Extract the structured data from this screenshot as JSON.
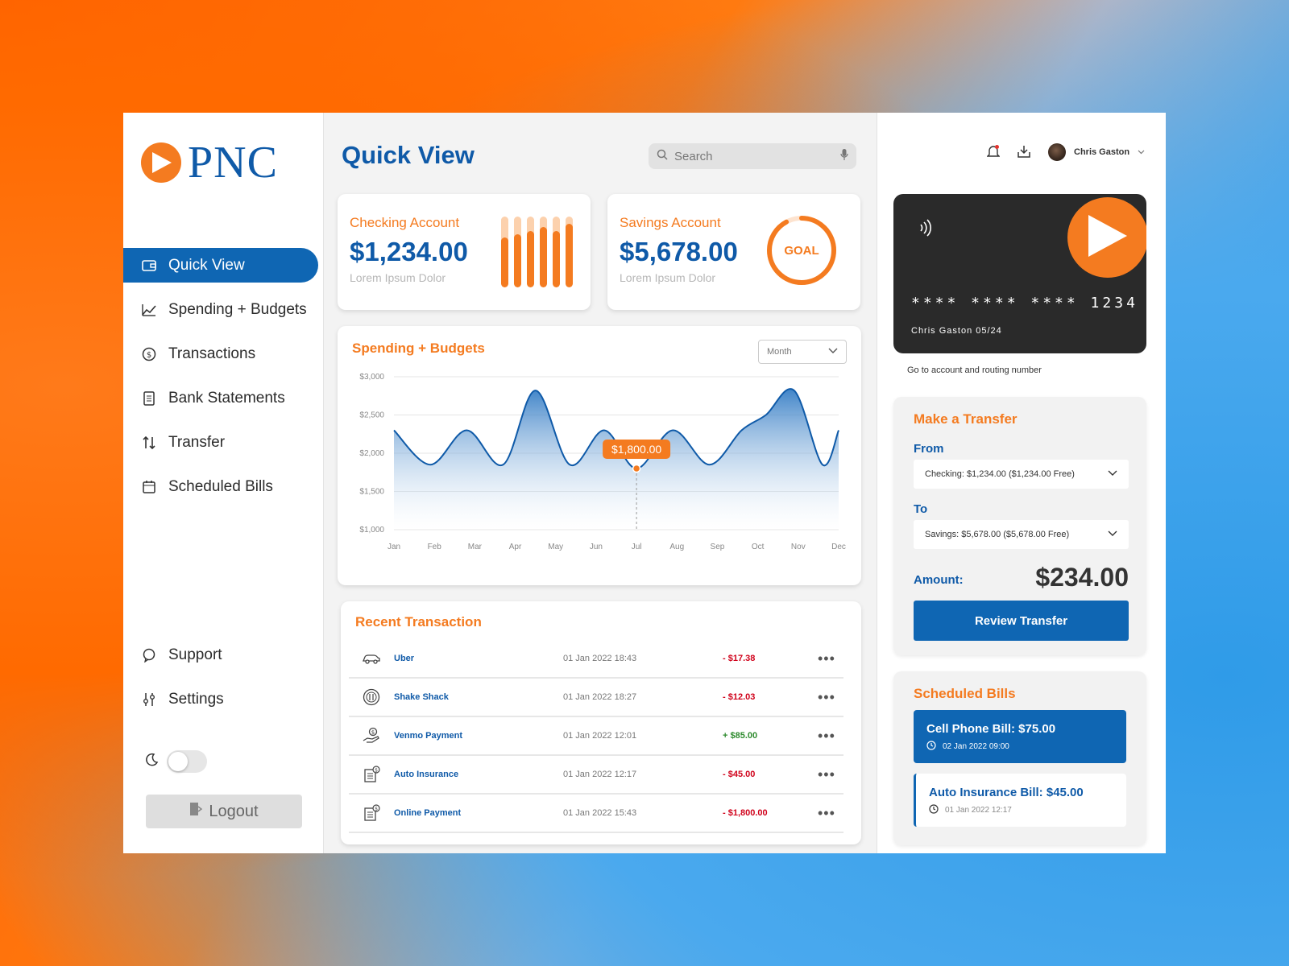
{
  "brand": {
    "name": "PNC"
  },
  "sidebar": {
    "items": [
      {
        "label": "Quick View",
        "icon": "wallet-icon",
        "active": true
      },
      {
        "label": "Spending + Budgets",
        "icon": "trend-icon"
      },
      {
        "label": "Transactions",
        "icon": "dollar-circle-icon"
      },
      {
        "label": "Bank Statements",
        "icon": "statement-icon"
      },
      {
        "label": "Transfer",
        "icon": "transfer-icon"
      },
      {
        "label": "Scheduled Bills",
        "icon": "calendar-icon"
      }
    ],
    "bottom_items": [
      {
        "label": "Support",
        "icon": "support-icon"
      },
      {
        "label": "Settings",
        "icon": "settings-icon"
      }
    ],
    "logout_label": "Logout",
    "dark_mode": false
  },
  "main": {
    "title": "Quick View",
    "search_placeholder": "Search",
    "checking": {
      "label": "Checking Account",
      "value": "$1,234.00",
      "sub": "Lorem Ipsum Dolor",
      "bar_levels": [
        0.7,
        0.75,
        0.8,
        0.85,
        0.8,
        0.9
      ]
    },
    "savings": {
      "label": "Savings Account",
      "value": "$5,678.00",
      "sub": "Lorem Ipsum Dolor",
      "goal_label": "GOAL",
      "goal_progress": 0.92
    },
    "spending": {
      "title": "Spending + Budgets",
      "period": "Month"
    },
    "recent": {
      "title": "Recent Transaction",
      "rows": [
        {
          "icon": "car-icon",
          "name": "Uber",
          "date": "01 Jan 2022 18:43",
          "amount": "- $17.38",
          "sign": "neg"
        },
        {
          "icon": "food-icon",
          "name": "Shake Shack",
          "date": "01 Jan 2022 18:27",
          "amount": "- $12.03",
          "sign": "neg"
        },
        {
          "icon": "payment-icon",
          "name": "Venmo Payment",
          "date": "01 Jan 2022 12:01",
          "amount": "+ $85.00",
          "sign": "pos"
        },
        {
          "icon": "bill-icon",
          "name": "Auto Insurance",
          "date": "01 Jan 2022 12:17",
          "amount": "- $45.00",
          "sign": "neg"
        },
        {
          "icon": "bill-icon",
          "name": "Online Payment",
          "date": "01 Jan 2022 15:43",
          "amount": "- $1,800.00",
          "sign": "neg"
        }
      ]
    }
  },
  "chart_data": {
    "type": "area",
    "title": "Spending + Budgets",
    "categories": [
      "Jan",
      "Feb",
      "Mar",
      "Apr",
      "May",
      "Jun",
      "Jul",
      "Aug",
      "Sep",
      "Oct",
      "Nov",
      "Dec"
    ],
    "x": [
      0,
      0.5,
      1,
      1.5,
      2,
      2.5,
      3,
      3.5,
      4,
      4.5,
      5,
      5.5,
      6,
      6.5,
      7,
      7.5,
      8,
      8.5,
      9,
      9.5,
      10,
      10.5,
      11
    ],
    "values": [
      2300,
      1850,
      2300,
      1850,
      2820,
      1850,
      2300,
      1800,
      2300,
      1850,
      2300,
      2500,
      2820,
      1850,
      2300
    ],
    "series_x": [
      0,
      0.9,
      1.8,
      2.7,
      3.5,
      4.35,
      5.2,
      6.0,
      6.9,
      7.8,
      8.6,
      9.2,
      9.9,
      10.6,
      11.0
    ],
    "ylim": [
      1000,
      3000
    ],
    "yticks": [
      "$3,000",
      "$2,500",
      "$2,000",
      "$1,500",
      "$1,000"
    ],
    "ytick_values": [
      3000,
      2500,
      2000,
      1500,
      1000
    ],
    "highlight": {
      "label": "$1,800.00",
      "x": 6.0,
      "value": 1800
    },
    "grid": true,
    "color": "#0f5aa8"
  },
  "right": {
    "user_name": "Chris Gaston",
    "card": {
      "number": "**** **** **** 1234",
      "holder": "Chris Gaston   05/24"
    },
    "card_link": "Go to account and routing number",
    "transfer": {
      "title": "Make a Transfer",
      "from_label": "From",
      "from_value": "Checking: $1,234.00 ($1,234.00 Free)",
      "to_label": "To",
      "to_value": "Savings: $5,678.00 ($5,678.00 Free)",
      "amount_label": "Amount:",
      "amount_value": "$234.00",
      "button": "Review Transfer"
    },
    "bills": {
      "title": "Scheduled Bills",
      "items": [
        {
          "title": "Cell Phone Bill: $75.00",
          "date": "02 Jan 2022 09:00"
        },
        {
          "title": "Auto Insurance Bill: $45.00",
          "date": "01 Jan 2022 12:17"
        }
      ]
    }
  },
  "colors": {
    "accent": "#f47b20",
    "brand_blue": "#0f5aa8",
    "negative": "#d0021b",
    "positive": "#2e8b2e"
  }
}
